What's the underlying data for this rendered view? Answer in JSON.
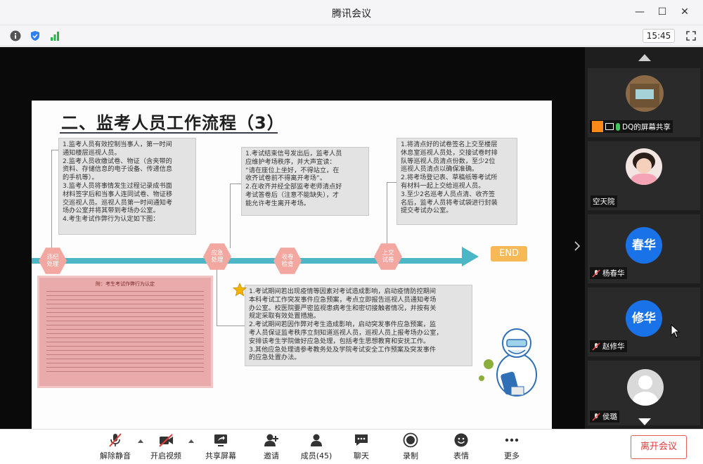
{
  "window": {
    "title": "腾讯会议"
  },
  "status": {
    "time": "15:45"
  },
  "slide": {
    "title": "二、监考人员工作流程（3）",
    "box1": [
      "1.监考人员有效控制当事人，第一时间",
      "通知楼层巡视人员。",
      "2.监考人员收缴试卷、物证（含夹带的",
      "资料、存储信息的电子设备、传递信息",
      "的手机等）。",
      "3.监考人员将事情发生过程记录成书面",
      "材料签字后和当事人连同试卷、物证移",
      "交巡视人员。巡视人员第一时间通知考",
      "场办公室并将其带到考场办公室。",
      "4.考生考试作弊行为认定如下图："
    ],
    "box2": [
      "1.考试结束信号发出后，监考人员",
      "应维护考场秩序，并大声宣读：",
      "“请在座位上坐好，不得站立，在",
      "收齐试卷前不得离开考场”。",
      "2.在收齐并经全部监考老师清点好",
      "考试答卷后（注意不能缺失），才",
      "能允许考生离开考场。"
    ],
    "box3": [
      "1.将清点好的试卷签名上交至楼层",
      "休息室巡视人员处，交接试卷时排",
      "队等巡视人员清点份数，至少2位",
      "巡视人员清点以确保准确。",
      "2.将考场登记表、草稿纸等考试所",
      "有材料一起上交给巡视人员。",
      "3.至少2名巡考人员点清、收齐签",
      "名后，监考人员将考试袋进行封装",
      "提交考试办公室。"
    ],
    "box4": [
      "1.考试期间若出现疫情等因素对考试造成影响，启动疫情防控期间",
      "本科考试工作突发事件应急预案，考点立即报告巡视人员通知考场",
      "办公室。校医院要严密监视患病考生和密切接触者情况，并按有关",
      "规定采取有效处置措施。",
      "2.考试期间若因作弊对考生造成影响，启动突发事件应急预案，监",
      "考人员保证监考秩序立刻知道巡视人员，巡视人员上报考场办公室，",
      "安排该考生学院做好应急处理，包括考生思想教育和安抚工作。",
      "3.其他应急处理请参考教务处及学院考试安全工作预案及突发事件",
      "的应急处置办法。"
    ],
    "hexes": [
      {
        "l1": "违纪",
        "l2": "处理"
      },
      {
        "l1": "应急",
        "l2": "处理"
      },
      {
        "l1": "收卷",
        "l2": "检查"
      },
      {
        "l1": "上交",
        "l2": "试卷"
      }
    ],
    "end_label": "END",
    "doc_title": "附：考生考试作弊行为认定"
  },
  "participants": [
    {
      "name": "DQ的屏幕共享",
      "type": "photo"
    },
    {
      "name": "空天院",
      "type": "photo"
    },
    {
      "name": "杨春华",
      "type": "text",
      "avatar": "春华"
    },
    {
      "name": "赵修华",
      "type": "text",
      "avatar": "修华"
    },
    {
      "name": "侯璐",
      "type": "default"
    }
  ],
  "toolbar": {
    "mute": "解除静音",
    "video": "开启视频",
    "share": "共享屏幕",
    "invite": "邀请",
    "members": "成员(45)",
    "chat": "聊天",
    "record": "录制",
    "emoji": "表情",
    "more": "更多",
    "leave": "离开会议"
  },
  "colors": {
    "accent_teal": "#4db6c6",
    "hex_pink": "#f2a7a0",
    "end_orange": "#f7b955",
    "avatar_blue": "#1a72e8",
    "leave_red": "#e23c3c"
  }
}
